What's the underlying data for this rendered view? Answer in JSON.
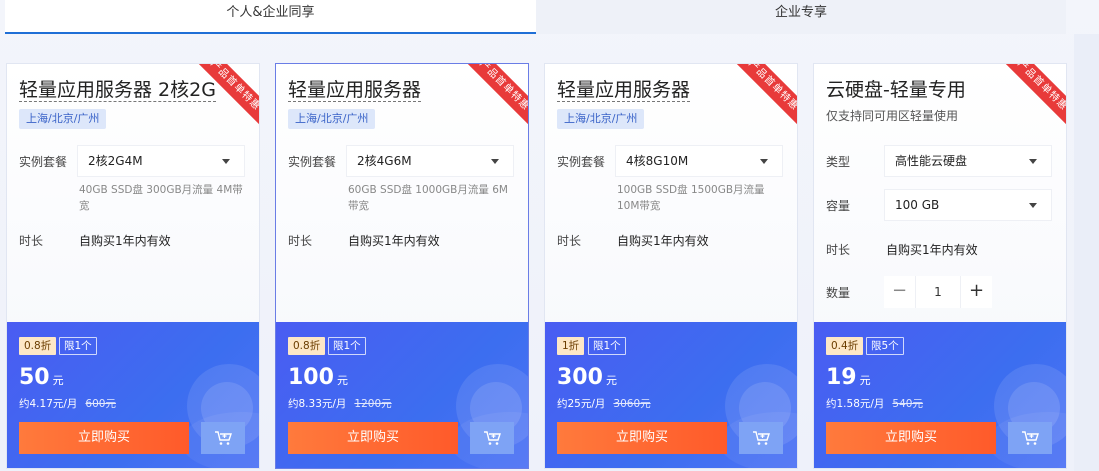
{
  "tabs": [
    {
      "label": "个人&企业同享",
      "active": true
    },
    {
      "label": "企业专享",
      "active": false
    }
  ],
  "cards": [
    {
      "ribbon": "产品首单特惠",
      "title": "轻量应用服务器 2核2G",
      "region": "上海/北京/广州",
      "package_label": "实例套餐",
      "package_value": "2核2G4M",
      "spec": "40GB SSD盘 300GB月流量 4M带宽",
      "duration_label": "时长",
      "duration_value": "自购买1年内有效",
      "discount": "0.8折",
      "limit": "限1个",
      "price": "50",
      "price_unit": "元",
      "monthly": "约4.17元/月",
      "original": "600元",
      "buy_label": "立即购买"
    },
    {
      "ribbon": "产品首单特惠",
      "title": "轻量应用服务器",
      "region": "上海/北京/广州",
      "package_label": "实例套餐",
      "package_value": "2核4G6M",
      "spec": "60GB SSD盘 1000GB月流量 6M带宽",
      "duration_label": "时长",
      "duration_value": "自购买1年内有效",
      "discount": "0.8折",
      "limit": "限1个",
      "price": "100",
      "price_unit": "元",
      "monthly": "约8.33元/月",
      "original": "1200元",
      "buy_label": "立即购买"
    },
    {
      "ribbon": "产品首单特惠",
      "title": "轻量应用服务器",
      "region": "上海/北京/广州",
      "package_label": "实例套餐",
      "package_value": "4核8G10M",
      "spec": "100GB SSD盘 1500GB月流量 10M带宽",
      "duration_label": "时长",
      "duration_value": "自购买1年内有效",
      "discount": "1折",
      "limit": "限1个",
      "price": "300",
      "price_unit": "元",
      "monthly": "约25元/月",
      "original": "3060元",
      "buy_label": "立即购买"
    },
    {
      "ribbon": "产品首单特惠",
      "title": "云硬盘-轻量专用",
      "subtitle": "仅支持同可用区轻量使用",
      "type_label": "类型",
      "type_value": "高性能云硬盘",
      "capacity_label": "容量",
      "capacity_value": "100 GB",
      "duration_label": "时长",
      "duration_value": "自购买1年内有效",
      "quantity_label": "数量",
      "quantity_value": "1",
      "minus": "−",
      "plus": "+",
      "discount": "0.4折",
      "limit": "限5个",
      "price": "19",
      "price_unit": "元",
      "monthly": "约1.58元/月",
      "original": "540元",
      "buy_label": "立即购买"
    }
  ],
  "icons": {
    "cart": "cart-icon",
    "caret": "chevron-down-icon"
  },
  "colors": {
    "accent": "#1f6fd6",
    "ribbon": "#e83a3a",
    "buy": "#ff6a30",
    "panel": "#4a5cf2"
  }
}
